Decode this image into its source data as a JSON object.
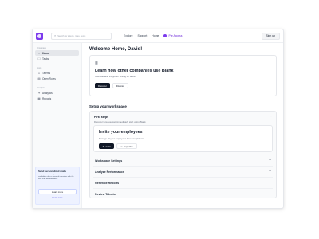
{
  "header": {
    "search_placeholder": "Search for tokens, roles, items",
    "nav": [
      "Explore",
      "Support",
      "Home"
    ],
    "beta_label": "Pre Access",
    "signup_label": "Sign up"
  },
  "sidebar": {
    "sections": [
      {
        "label": "Company",
        "items": [
          {
            "label": "Home",
            "icon": "home-icon"
          },
          {
            "label": "Tasks",
            "icon": "tasks-icon"
          }
        ]
      },
      {
        "label": "Lists",
        "items": [
          {
            "label": "Talents",
            "icon": "talents-icon"
          },
          {
            "label": "Open Roles",
            "icon": "open-roles-icon"
          }
        ]
      },
      {
        "label": "Insights",
        "items": [
          {
            "label": "Analytics",
            "icon": "analytics-icon"
          },
          {
            "label": "Reports",
            "icon": "reports-icon"
          }
        ]
      }
    ],
    "promo": {
      "title": "Send personalized mails",
      "text": "Lead times to send personalized mails to each candidates after a round of interviews with the help of AI documentation.",
      "button": "Learn more",
      "link": "Learn more"
    }
  },
  "main": {
    "welcome": "Welcome Home, David!",
    "learn": {
      "title": "Learn how other companies use Blank",
      "subtitle": "Gain valuable insight for setting up Blank.",
      "discover": "Discover",
      "dismiss": "Dismiss"
    },
    "setup_title": "Setup your workspace",
    "first_steps": {
      "title": "First steps",
      "subtitle": "Discover how you can immediately start using Blank."
    },
    "invite": {
      "title": "Invite your employees",
      "subtitle": "Manage all your employees from one platform.",
      "invite_btn": "Invite",
      "copy_btn": "Copy link"
    },
    "accordion": [
      "Workspace Settings",
      "Analyze Performance",
      "Generate Reports",
      "Review Talents"
    ]
  },
  "colors": {
    "accent": "#7c3aed",
    "dark_button": "#111827",
    "promo_bg": "#eef2ff"
  }
}
